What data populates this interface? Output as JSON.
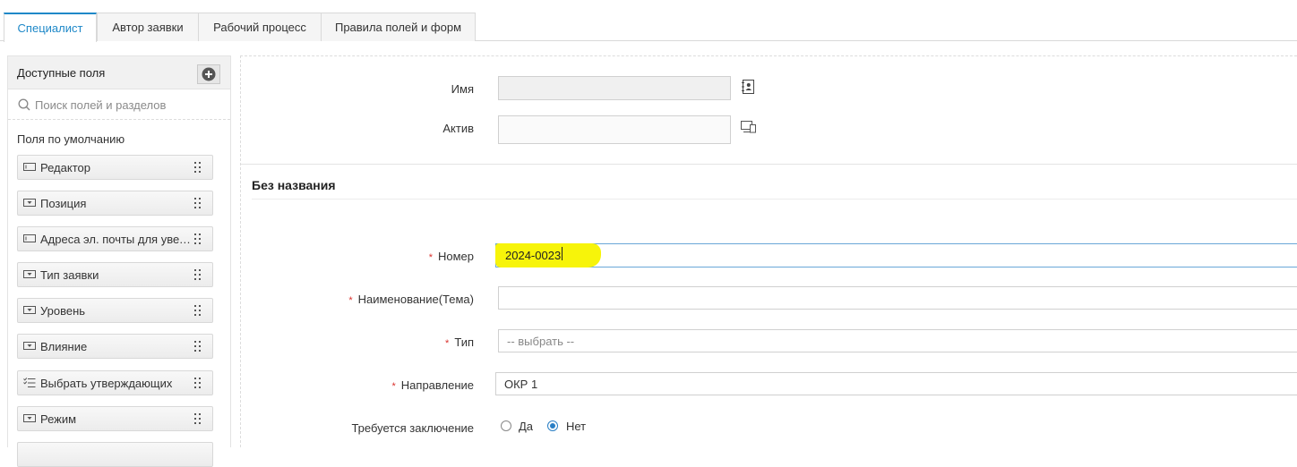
{
  "tabs": [
    {
      "label": "Специалист",
      "active": true
    },
    {
      "label": "Автор заявки",
      "active": false
    },
    {
      "label": "Рабочий процесс",
      "active": false
    },
    {
      "label": "Правила полей и форм",
      "active": false
    }
  ],
  "left_panel": {
    "title": "Доступные поля",
    "search_placeholder": "Поиск полей и разделов",
    "section_label": "Поля по умолчанию",
    "fields": [
      {
        "label": "Редактор",
        "icon": "text-field-icon"
      },
      {
        "label": "Позиция",
        "icon": "dropdown-field-icon"
      },
      {
        "label": "Адреса эл. почты для уведомлений",
        "icon": "text-field-icon"
      },
      {
        "label": "Тип заявки",
        "icon": "dropdown-field-icon"
      },
      {
        "label": "Уровень",
        "icon": "dropdown-field-icon"
      },
      {
        "label": "Влияние",
        "icon": "dropdown-field-icon"
      },
      {
        "label": "Выбрать утверждающих",
        "icon": "checklist-field-icon"
      },
      {
        "label": "Режим",
        "icon": "dropdown-field-icon"
      }
    ]
  },
  "form": {
    "name_label": "Имя",
    "name_value": "",
    "asset_label": "Актив",
    "asset_value": "",
    "section_title": "Без названия",
    "number_label": "Номер",
    "number_value": "2024-0023",
    "subject_label": "Наименование(Тема)",
    "subject_value": "",
    "type_label": "Тип",
    "type_placeholder": "-- выбрать --",
    "direction_label": "Направление",
    "direction_value": "ОКР 1",
    "conclusion_label": "Требуется заключение",
    "conclusion_options": [
      {
        "label": "Да",
        "checked": false
      },
      {
        "label": "Нет",
        "checked": true
      }
    ]
  },
  "colors": {
    "accent": "#1e88c8",
    "required": "#d9302c",
    "highlight": "#f7f40a"
  }
}
